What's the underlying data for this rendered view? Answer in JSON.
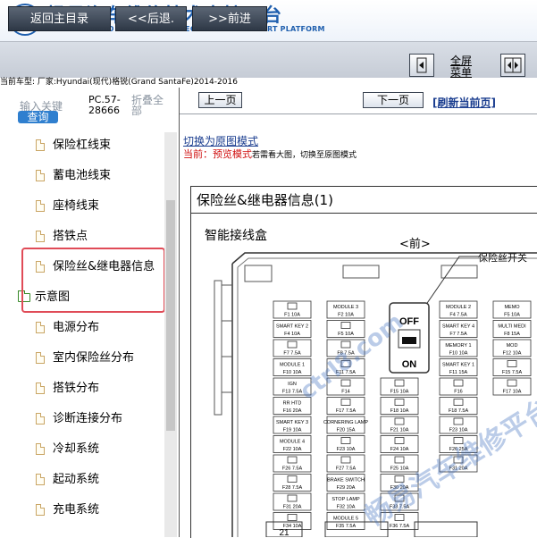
{
  "header": {
    "title_cn": "畅易汽车维修技术支持平台",
    "title_en": "CHANG YI AUTO MAINTENANCE TECHNOLOGY SUPPORT PLATFORM",
    "brand_color": "#1f5fae"
  },
  "toolbar": {
    "home_label": "返回主目录",
    "back_label": "<<后退.",
    "forward_label": ">>前进",
    "fullscreen_line1": "全屏",
    "fullscreen_line2": "菜单"
  },
  "car_model": "当前车型:   厂家:Hyundai(现代)格锐(Grand SantaFe)2014-2016",
  "search": {
    "keyword_label": "输入关键",
    "query_label": "查询",
    "code": "PC.57-28666",
    "collapse_all": "折叠全部"
  },
  "tree": {
    "items": [
      {
        "label": "保险杠线束",
        "icon": "document-icon"
      },
      {
        "label": "蓄电池线束",
        "icon": "document-icon"
      },
      {
        "label": "座椅线束",
        "icon": "document-icon"
      },
      {
        "label": "搭铁点",
        "icon": "document-icon"
      },
      {
        "label": "保险丝&继电器信息",
        "icon": "document-icon"
      },
      {
        "label": "示意图",
        "icon": "folder-open-icon"
      },
      {
        "label": "电源分布",
        "icon": "document-icon"
      },
      {
        "label": "室内保险丝分布",
        "icon": "document-icon"
      },
      {
        "label": "搭铁分布",
        "icon": "document-icon"
      },
      {
        "label": "诊断连接分布",
        "icon": "document-icon"
      },
      {
        "label": "冷却系统",
        "icon": "document-icon"
      },
      {
        "label": "起动系统",
        "icon": "document-icon"
      },
      {
        "label": "充电系统",
        "icon": "document-icon"
      }
    ],
    "highlight_color": "#e04b57"
  },
  "viewer": {
    "prev_page": "上一页",
    "next_page": "下一页",
    "refresh": "[刷新当前页]",
    "switch_mode": "切换为原图模式",
    "current_prefix": "当前：",
    "current_mode": "预览模式",
    "current_hint": "若需看大图，切换至原图模式"
  },
  "diagram": {
    "title": "保险丝&继电器信息(1)",
    "subtitle": "智能接线盒",
    "front": "<前>",
    "fuse_switch": "保险丝开关",
    "off": "OFF",
    "on": "ON",
    "connector_no": "21",
    "fuses_col1": [
      "F1 10A",
      "F4 10A",
      "F7 7.5A",
      "F10 10A",
      "F13 7.5A",
      "F16 20A",
      "F19 10A",
      "F22 10A",
      "F26 7.5A",
      "F28 7.5A",
      "F31 20A",
      "F34 10A",
      "F38 15A"
    ],
    "fuses_col2": [
      "F2 10A",
      "F5 10A",
      "F8 7.5A",
      "F11 7.5A",
      "F14",
      "F17 7.5A",
      "F20 15A",
      "F23 10A",
      "F27 7.5A",
      "F29 20A",
      "F32 10A",
      "F35 7.5A",
      "F39 10A",
      "F43 10A"
    ],
    "fuses_col3": [
      "F3 7.5A",
      "F6 10A",
      "F9 10A",
      "F12 10A",
      "F15 10A",
      "F18 10A",
      "F21 10A",
      "F24 10A",
      "F25 10A",
      "F30 20A",
      "F33 7.5A",
      "F36 7.5A",
      "F40 15A",
      "F44 20A"
    ],
    "fuses_col4": [
      "F4 7.5A",
      "F7 7.5A",
      "F10 10A",
      "F11 15A",
      "F16",
      "F18 7.5A",
      "F23 10A",
      "F26 25A",
      "F31 20A"
    ],
    "fuses_col5": [
      "F5 10A",
      "F8 15A",
      "F12 10A",
      "F15 7.5A",
      "F17 10A"
    ],
    "labels_col1": [
      "",
      "SMART KEY 2",
      "",
      "MODULE 1",
      "IGN",
      "RR HTD",
      "SMART KEY 3",
      "MODULE 4"
    ],
    "labels_col2": [
      "MODULE 3",
      "",
      "",
      "",
      "",
      "",
      "CORNERING LAMP",
      "",
      "",
      "BRAKE SWITCH",
      "STOP LAMP",
      "MODULE 5"
    ],
    "labels_col4": [
      "MODULE 2",
      "SMART KEY 4",
      "MEMORY 1",
      "SMART KEY 1"
    ],
    "labels_col5": [
      "MEMO",
      "MULTI MEDI",
      "MOD"
    ]
  },
  "watermarks": [
    "ctrl8.com",
    "畅易汽车维修平台"
  ]
}
